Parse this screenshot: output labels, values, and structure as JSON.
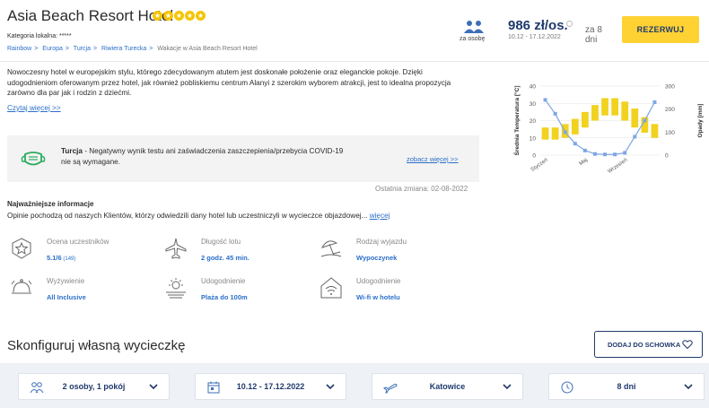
{
  "header": {
    "title": "Asia Beach Resort Hotel",
    "stars": 5,
    "local_category": "Kategoria lokalna: *****",
    "breadcrumb": [
      "Rainbow",
      "Europa",
      "Turcja",
      "Riwiera Turecka"
    ],
    "breadcrumb_current": "Wakacje w Asia Beach Resort Hotel",
    "per_person_label": "za osobę",
    "price": "986 zł/os.",
    "price_dates": "10.12 - 17.12.2022",
    "days": "za 8 dni",
    "reserve_label": "REZERWUJ"
  },
  "description": {
    "text": "Nowoczesny hotel w europejskim stylu, którego zdecydowanym atutem jest doskonałe położenie oraz eleganckie pokoje. Dzięki udogodnieniom oferowanym przez hotel, jak również pobliskiemu centrum Alanyi z szerokim wyborem atrakcji, jest to idealna propozycja zarówno dla par jak i rodzin z dziećmi.",
    "read_more": "Czytaj więcej >>"
  },
  "covid": {
    "country": "Turcja",
    "text": " - Negatywny wynik testu ani zaświadczenia zaszczepienia/przebycia COVID-19 nie są wymagane.",
    "more": "zobacz więcej >>",
    "last_change": "Ostatnia zmiana: 02-08-2022"
  },
  "key_info": {
    "title": "Najważniejsze informacje",
    "desc": "Opinie pochodzą od naszych Klientów, którzy odwiedzili dany hotel lub uczestniczyli w wycieczce objazdowej...",
    "desc_link": "więcej",
    "features": [
      {
        "label": "Ocena uczestników",
        "value": "5.1/6",
        "extra": " (149)",
        "icon": "rating-star-icon"
      },
      {
        "label": "Długość lotu",
        "value": "2 godz. 45 min.",
        "extra": "",
        "icon": "airplane-icon"
      },
      {
        "label": "Rodzaj wyjazdu",
        "value": "Wypoczynek",
        "extra": "",
        "icon": "beach-umbrella-icon"
      },
      {
        "label": "Wyżywienie",
        "value": "All Inclusive",
        "extra": "",
        "icon": "food-cloche-icon"
      },
      {
        "label": "Udogodnienie",
        "value": "Plaża do 100m",
        "extra": "",
        "icon": "sun-sea-icon"
      },
      {
        "label": "Udogodnienie",
        "value": "Wi-fi w hotelu",
        "extra": "",
        "icon": "wifi-house-icon"
      }
    ]
  },
  "config": {
    "title": "Skonfiguruj własną wycieczkę",
    "stash_label": "DODAJ DO SCHOWKA",
    "dropdowns": [
      {
        "value": "2 osoby, 1 pokój",
        "icon": "people-icon"
      },
      {
        "value": "10.12 - 17.12.2022",
        "icon": "calendar-icon"
      },
      {
        "value": "Katowice",
        "icon": "plane-departure-icon"
      },
      {
        "value": "8 dni",
        "icon": "clock-icon"
      }
    ]
  },
  "chart_data": {
    "type": "bar",
    "ylabel": "Średnia Temperatura [°C]",
    "y2label": "Opady [mm]",
    "ylim": [
      0,
      40
    ],
    "y2lim": [
      0,
      300
    ],
    "yticks": [
      "0",
      "10",
      "20",
      "30",
      "40"
    ],
    "y2ticks": [
      "0",
      "100",
      "200",
      "300"
    ],
    "xtick_labels": [
      "Styczeń",
      "Maj",
      "Wrzesień"
    ],
    "temperature_ranges": [
      [
        9,
        16
      ],
      [
        9,
        16
      ],
      [
        10,
        18
      ],
      [
        12,
        21
      ],
      [
        16,
        25
      ],
      [
        20,
        29
      ],
      [
        23,
        33
      ],
      [
        23,
        33
      ],
      [
        20,
        31
      ],
      [
        16,
        27
      ],
      [
        13,
        22
      ],
      [
        10,
        18
      ]
    ],
    "precipitation": [
      240,
      180,
      100,
      50,
      20,
      5,
      3,
      3,
      10,
      80,
      150,
      230
    ],
    "colors": {
      "bars": "#f1d21e",
      "line": "#7ea6e3"
    }
  }
}
